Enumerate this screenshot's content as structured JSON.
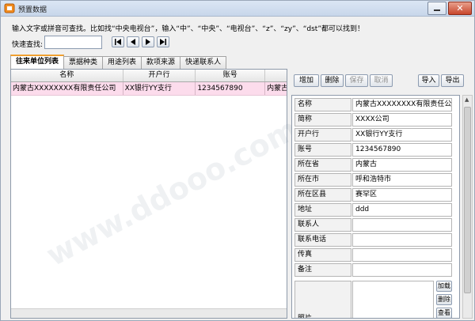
{
  "window": {
    "title": "预置数据",
    "close_symbol": "✕"
  },
  "hint": "输入文字或拼音可查找。比如找“中央电视台”，输入“中”、“中央”、“电视台”、“z”、“zy”、“dst”都可以找到！",
  "search": {
    "label": "快速查找:",
    "value": "",
    "placeholder": ""
  },
  "nav": {
    "first": "|◀",
    "prev": "◀",
    "next": "▶",
    "last": "▶|"
  },
  "tabs": [
    {
      "label": "往来单位列表",
      "active": true
    },
    {
      "label": "票据种类",
      "active": false
    },
    {
      "label": "用途列表",
      "active": false
    },
    {
      "label": "款项来源",
      "active": false
    },
    {
      "label": "快递联系人",
      "active": false
    }
  ],
  "grid": {
    "columns": [
      "名称",
      "开户行",
      "账号"
    ],
    "rows": [
      [
        "内蒙古XXXXXXXX有限责任公司",
        "XX银行YY支行",
        "1234567890",
        "内蒙古"
      ]
    ]
  },
  "toolbar": {
    "add": "增加",
    "delete": "删除",
    "save": "保存",
    "cancel": "取消",
    "import": "导入",
    "export": "导出"
  },
  "form": {
    "fields": [
      {
        "label": "名称",
        "value": "内蒙古XXXXXXXX有限责任公司"
      },
      {
        "label": "简称",
        "value": "XXXX公司"
      },
      {
        "label": "开户行",
        "value": "XX银行YY支行"
      },
      {
        "label": "账号",
        "value": "1234567890"
      },
      {
        "label": "所在省",
        "value": "内蒙古"
      },
      {
        "label": "所在市",
        "value": "呼和浩特市"
      },
      {
        "label": "所在区县",
        "value": "赛罕区"
      },
      {
        "label": "地址",
        "value": "ddd"
      },
      {
        "label": "联系人",
        "value": ""
      },
      {
        "label": "联系电话",
        "value": ""
      },
      {
        "label": "传真",
        "value": ""
      },
      {
        "label": "备注",
        "value": ""
      }
    ],
    "photo_label": "照片",
    "photo_load": "加载",
    "photo_delete": "删除",
    "photo_view": "查看"
  },
  "colors": {
    "selected_row": "#fcdcec",
    "active_tab_accent": "#f0a030"
  }
}
